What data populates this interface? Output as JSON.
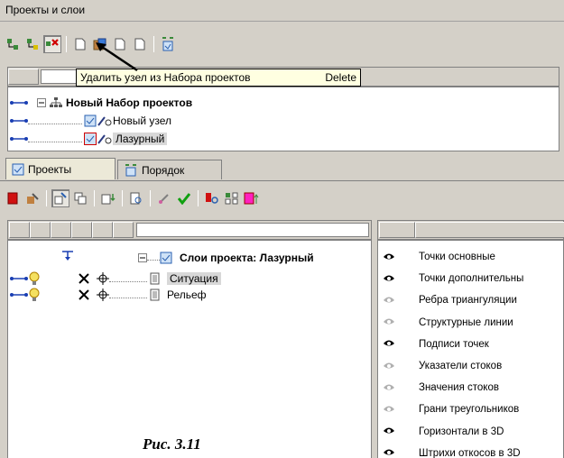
{
  "window": {
    "title": "Проекты и слои"
  },
  "tooltip": {
    "text": "Удалить узел из Набора проектов",
    "shortcut": "Delete"
  },
  "project_tree": {
    "root": "Новый Набор проектов",
    "children": [
      {
        "label": "Новый узел"
      },
      {
        "label": "Лазурный"
      }
    ]
  },
  "tabs": [
    {
      "label": "Проекты"
    },
    {
      "label": "Порядок"
    }
  ],
  "layers_tree": {
    "root": "Слои проекта: Лазурный",
    "children": [
      {
        "label": "Ситуация"
      },
      {
        "label": "Рельеф"
      }
    ]
  },
  "layer_list": [
    {
      "label": "Точки основные",
      "visible": true
    },
    {
      "label": "Точки дополнительны",
      "visible": true
    },
    {
      "label": "Ребра триангуляции",
      "visible": false
    },
    {
      "label": "Структурные линии",
      "visible": false
    },
    {
      "label": "Подписи точек",
      "visible": true
    },
    {
      "label": "Указатели стоков",
      "visible": false
    },
    {
      "label": "Значения стоков",
      "visible": false
    },
    {
      "label": "Грани треугольников",
      "visible": false
    },
    {
      "label": "Горизонтали в 3D",
      "visible": true
    },
    {
      "label": "Штрихи откосов в 3D",
      "visible": true
    }
  ],
  "figure_caption": "Рис. 3.11",
  "colors": {
    "eye_on": "#000000",
    "eye_off": "#b0b0b0",
    "link_blue": "#1a3fb3",
    "bulb": "#e8c000"
  }
}
